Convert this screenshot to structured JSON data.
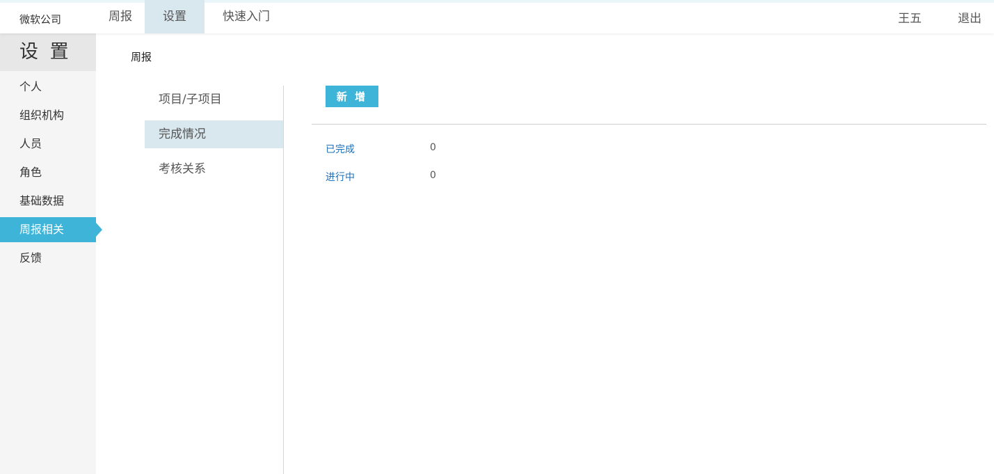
{
  "header": {
    "brand": "微软公司",
    "nav": [
      {
        "label": "周报"
      },
      {
        "label": "设置"
      },
      {
        "label": "快速入门"
      }
    ],
    "active_nav": "设置",
    "user_name": "王五",
    "logout_label": "退出"
  },
  "sidebar": {
    "title": "设 置",
    "items": [
      {
        "label": "个人"
      },
      {
        "label": "组织机构"
      },
      {
        "label": "人员"
      },
      {
        "label": "角色"
      },
      {
        "label": "基础数据"
      },
      {
        "label": "周报相关"
      },
      {
        "label": "反馈"
      }
    ],
    "active_item": "周报相关"
  },
  "breadcrumb": "周报",
  "subnav": {
    "items": [
      {
        "label": "项目/子项目"
      },
      {
        "label": "完成情况"
      },
      {
        "label": "考核关系"
      }
    ],
    "active_item": "完成情况"
  },
  "main": {
    "add_label": "新 增",
    "stats": [
      {
        "label": "已完成",
        "value": "0"
      },
      {
        "label": "进行中",
        "value": "0"
      }
    ]
  },
  "colors": {
    "accent": "#3eb4d9",
    "active_bg": "#d9e7ee",
    "link": "#1e6fb8"
  }
}
